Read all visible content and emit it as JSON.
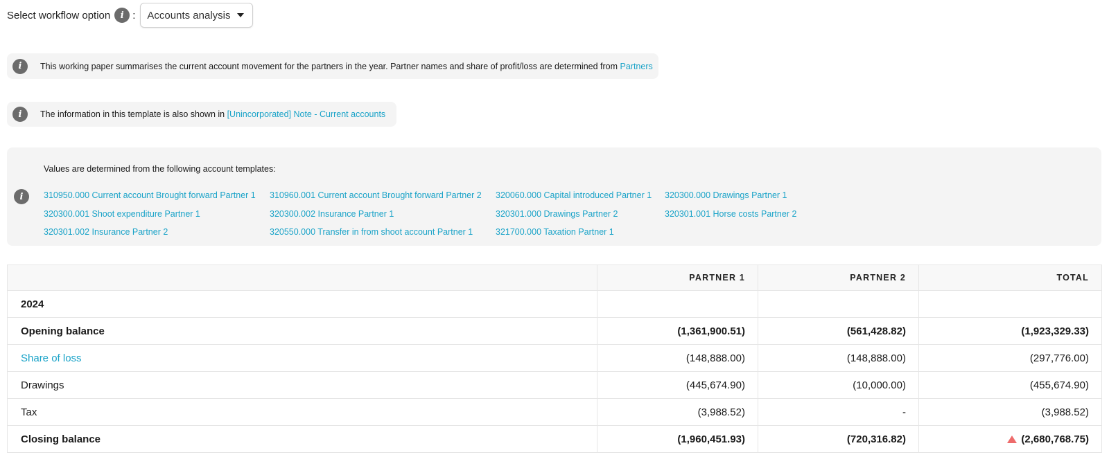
{
  "workflow": {
    "label": "Select workflow option",
    "colon": ":",
    "selected": "Accounts analysis"
  },
  "notes": [
    {
      "text": "This working paper summarises the current account movement for the partners in the year. Partner names and share of profit/loss are determined from ",
      "link": "Partners"
    },
    {
      "text": "The information in this template is also shown in ",
      "link": "[Unincorporated] Note - Current accounts"
    }
  ],
  "templates": {
    "heading": "Values are determined from the following account templates:",
    "links": [
      "310950.000 Current account Brought forward Partner 1",
      "310960.001 Current account Brought forward Partner 2",
      "320060.000 Capital introduced Partner 1",
      "320300.000 Drawings Partner 1",
      "320300.001 Shoot expenditure Partner 1",
      "320300.002 Insurance Partner 1",
      "320301.000 Drawings Partner 2",
      "320301.001 Horse costs Partner 2",
      "320301.002 Insurance Partner 2",
      "320550.000 Transfer in from shoot account Partner 1",
      "321700.000 Taxation Partner 1"
    ]
  },
  "table": {
    "headers": [
      "",
      "PARTNER 1",
      "PARTNER 2",
      "TOTAL"
    ],
    "year": "2024",
    "rows": [
      {
        "label": "Opening balance",
        "p1": "(1,361,900.51)",
        "p2": "(561,428.82)",
        "total": "(1,923,329.33)",
        "bold": true
      },
      {
        "label": "Share of loss",
        "p1": "(148,888.00)",
        "p2": "(148,888.00)",
        "total": "(297,776.00)",
        "link": true
      },
      {
        "label": "Drawings",
        "p1": "(445,674.90)",
        "p2": "(10,000.00)",
        "total": "(455,674.90)"
      },
      {
        "label": "Tax",
        "p1": "(3,988.52)",
        "p2": "-",
        "total": "(3,988.52)"
      },
      {
        "label": "Closing balance",
        "p1": "(1,960,451.93)",
        "p2": "(720,316.82)",
        "total": "2,680,768.75",
        "bold": true
      }
    ],
    "closing_total_display": "(2,680,768.75)"
  },
  "colors": {
    "link": "#1aa3c8",
    "warning": "#ee6b6b",
    "panel": "#f4f4f4"
  },
  "icons": {
    "info": "info-icon",
    "dropdown": "chevron-down-icon",
    "warning": "warning-triangle-icon"
  }
}
